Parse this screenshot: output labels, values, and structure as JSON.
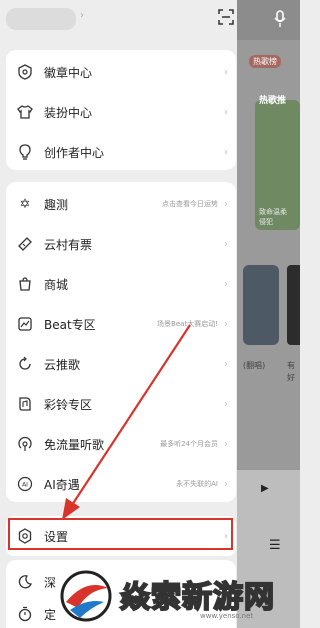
{
  "background_app": {
    "tag": "热歌榜",
    "heading": "热歌推",
    "card1_text": "致命温柔\n侵犯",
    "card2_text": "(翻唱)",
    "card3_text": "有\n好"
  },
  "group1": [
    {
      "label": "徽章中心",
      "icon": "badge-icon"
    },
    {
      "label": "装扮中心",
      "icon": "shirt-icon"
    },
    {
      "label": "创作者中心",
      "icon": "bulb-icon"
    }
  ],
  "group2": [
    {
      "label": "趣测",
      "sub": "点击查看今日运势",
      "icon": "star-icon"
    },
    {
      "label": "云村有票",
      "sub": "",
      "icon": "ticket-icon"
    },
    {
      "label": "商城",
      "sub": "",
      "icon": "bag-icon"
    },
    {
      "label": "Beat专区",
      "sub": "场景Beat大赛启动!",
      "icon": "chart-icon"
    },
    {
      "label": "云推歌",
      "sub": "",
      "icon": "refresh-icon"
    },
    {
      "label": "彩铃专区",
      "sub": "",
      "icon": "ringtone-icon"
    },
    {
      "label": "免流量听歌",
      "sub": "最多听24个月会员",
      "icon": "broadcast-icon"
    },
    {
      "label": "AI奇遇",
      "sub": "永不失联的AI",
      "icon": "ai-icon"
    }
  ],
  "settings": {
    "label": "设置",
    "icon": "gear-icon"
  },
  "group3": [
    {
      "label": "深",
      "icon": "moon-icon"
    },
    {
      "label": "定",
      "icon": "timer-icon"
    }
  ],
  "watermark": {
    "text": "焱索新游网",
    "url": "www.yenso.net"
  },
  "colors": {
    "accent": "#d9342b"
  }
}
